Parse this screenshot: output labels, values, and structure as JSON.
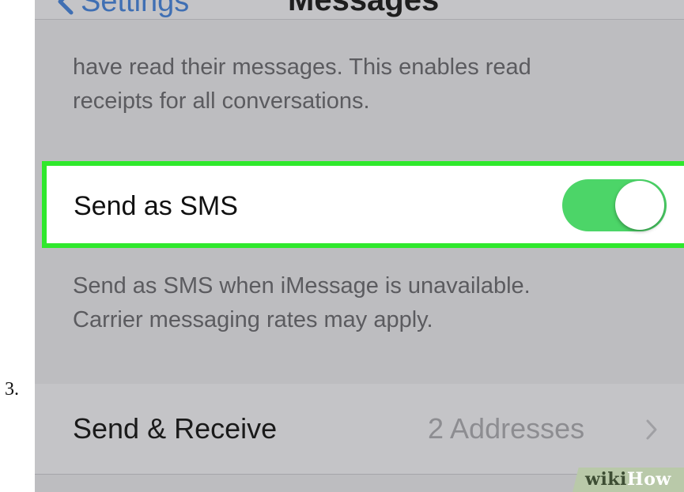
{
  "step_number": "3.",
  "navbar": {
    "back_label": "Settings",
    "back_icon": "chevron-left-icon",
    "title": "Messages"
  },
  "read_receipts_footer": {
    "line1": "have read their messages. This enables read",
    "line2": "receipts for all conversations."
  },
  "send_as_sms": {
    "label": "Send as SMS",
    "enabled": true,
    "highlight_color": "#2fe82c",
    "toggle_color": "#4cd568"
  },
  "sms_footer": {
    "line1": "Send as SMS when iMessage is unavailable.",
    "line2": "Carrier messaging rates may apply."
  },
  "send_receive": {
    "label": "Send & Receive",
    "value": "2 Addresses",
    "icon": "chevron-right-icon"
  },
  "watermark": {
    "part1": "wiki",
    "part2": "How"
  },
  "colors": {
    "accent": "#3f6fb3",
    "dimmed_background": "#bdbdc0"
  }
}
